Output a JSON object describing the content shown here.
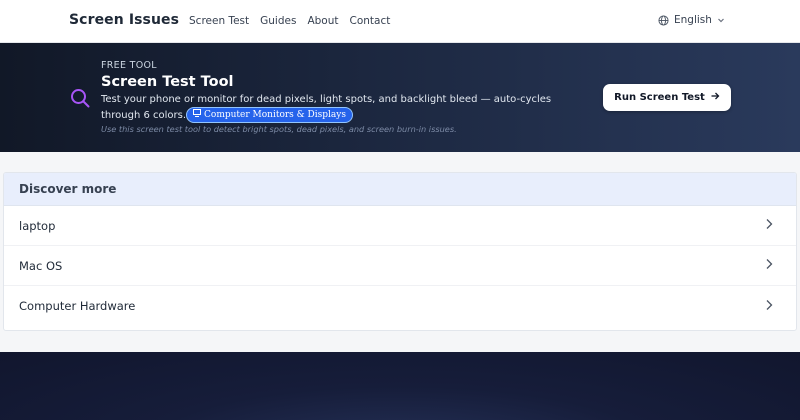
{
  "header": {
    "brand": "Screen Issues",
    "nav": [
      "Screen Test",
      "Guides",
      "About",
      "Contact"
    ],
    "language": "English"
  },
  "hero": {
    "eyebrow": "FREE TOOL",
    "title": "Screen Test Tool",
    "description": "Test your phone or monitor for dead pixels, light spots, and backlight bleed — auto-cycles through 6 colors.",
    "chip": "Computer Monitors & Displays",
    "subtext": "Use this screen test tool to detect bright spots, dead pixels, and screen burn-in issues.",
    "button": "Run Screen Test"
  },
  "discover": {
    "title": "Discover more",
    "items": [
      "laptop",
      "Mac OS",
      "Computer Hardware"
    ]
  },
  "colors": {
    "accent_icon": "#a855f7",
    "chip_bg": "#2563eb",
    "card_header_bg": "#e8eefc"
  }
}
